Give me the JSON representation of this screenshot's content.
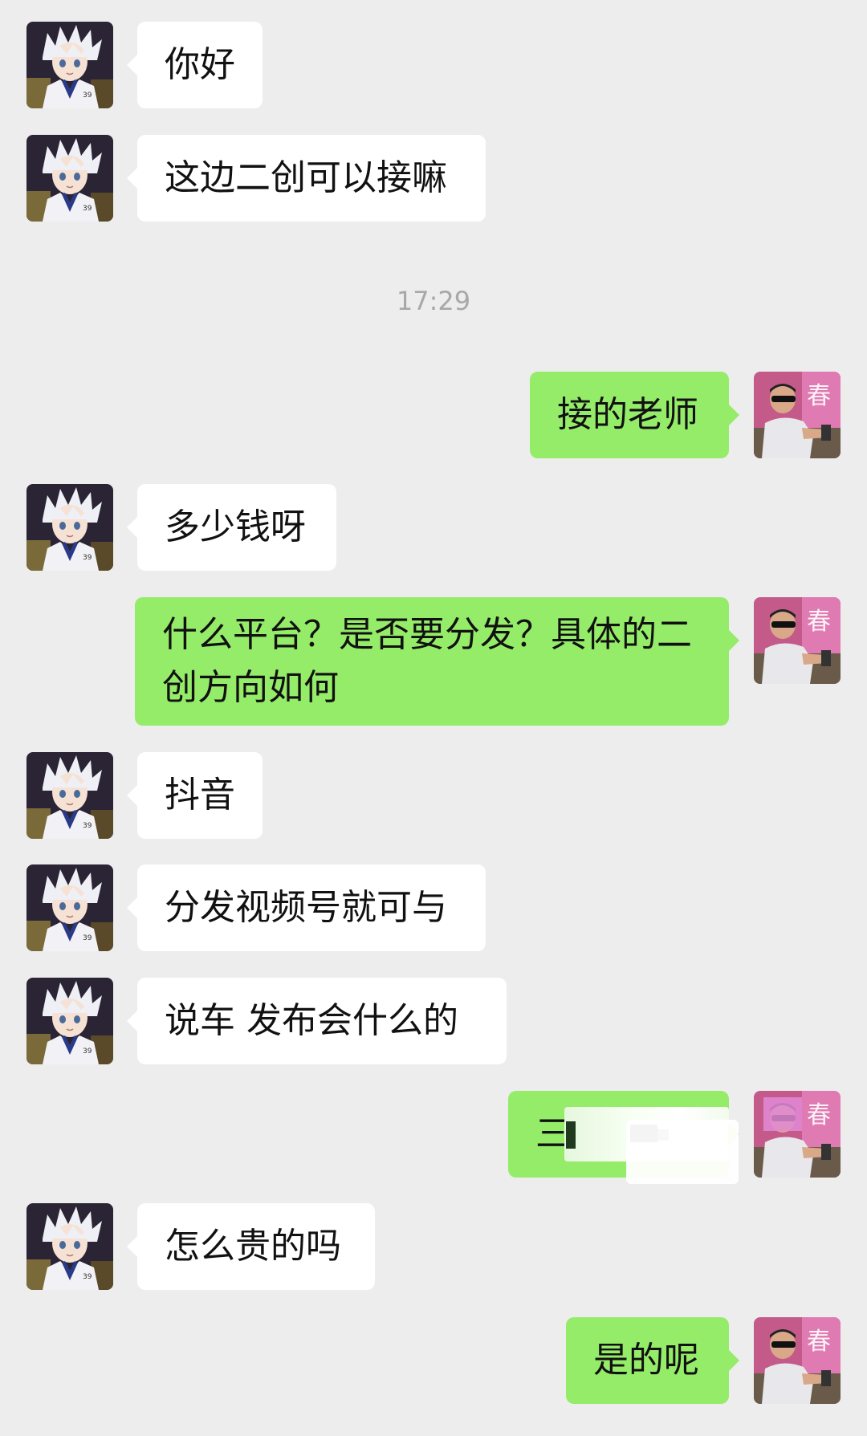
{
  "timestamp": "17:29",
  "messages": [
    {
      "side": "in",
      "text": "你好"
    },
    {
      "side": "in",
      "text": "这边二创可以接嘛"
    },
    {
      "side": "out",
      "text": "接的老师"
    },
    {
      "side": "in",
      "text": "多少钱呀"
    },
    {
      "side": "out",
      "text": "什么平台？是否要分发？具体的二创方向如何"
    },
    {
      "side": "in",
      "text": "抖音"
    },
    {
      "side": "in",
      "text": "分发视频号就可与"
    },
    {
      "side": "in",
      "text": "说车  发布会什么的"
    },
    {
      "side": "out",
      "text": "三",
      "redacted": true
    },
    {
      "side": "in",
      "text": "怎么贵的吗"
    },
    {
      "side": "out",
      "text": "是的呢"
    }
  ],
  "colors": {
    "background": "#ededed",
    "incoming_bubble": "#ffffff",
    "outgoing_bubble": "#95ec69",
    "timestamp_text": "#a8a8a8"
  },
  "icons": {
    "contact_avatar": "anime-boy-avatar",
    "self_avatar": "man-with-sunglasses-avatar"
  }
}
